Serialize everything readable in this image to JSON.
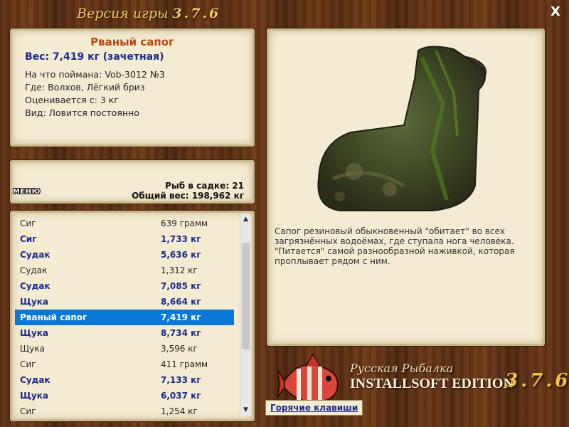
{
  "header": {
    "title": "Версия игры",
    "version": "3.7.6",
    "close_label": "X"
  },
  "info": {
    "name": "Рваный сапог",
    "weight": "Вес: 7,419 кг (зачетная)",
    "caught_on": "На что поймана: Vob-3012 №3",
    "where": "Где: Волхов, Лёгкий бриз",
    "valued_from": "Оценивается с: 3 кг",
    "kind": "Вид: Ловится постоянно"
  },
  "menu_label": "МЕНЮ",
  "stats": {
    "fish_count": "Рыб в садке: 21",
    "total_weight": "Общий вес: 198,962 кг"
  },
  "list": [
    {
      "name": "Сиг",
      "weight": "639 грамм",
      "style": "normal"
    },
    {
      "name": "Сиг",
      "weight": "1,733 кг",
      "style": "bold"
    },
    {
      "name": "Судак",
      "weight": "5,636 кг",
      "style": "bold"
    },
    {
      "name": "Судак",
      "weight": "1,312 кг",
      "style": "normal"
    },
    {
      "name": "Судак",
      "weight": "7,085 кг",
      "style": "bold"
    },
    {
      "name": "Щука",
      "weight": "8,664 кг",
      "style": "bold"
    },
    {
      "name": "Рваный сапог",
      "weight": "7,419 кг",
      "style": "selected"
    },
    {
      "name": "Щука",
      "weight": "8,734 кг",
      "style": "bold"
    },
    {
      "name": "Щука",
      "weight": "3,596 кг",
      "style": "normal"
    },
    {
      "name": "Сиг",
      "weight": "411 грамм",
      "style": "normal"
    },
    {
      "name": "Судак",
      "weight": "7,133 кг",
      "style": "bold"
    },
    {
      "name": "Щука",
      "weight": "6,037 кг",
      "style": "bold"
    },
    {
      "name": "Сиг",
      "weight": "1,254 кг",
      "style": "normal"
    }
  ],
  "description": "Сапог резиновый обыкновенный \"обитает\" во всех загрязнённых водоёмах, где ступала нога человека. \"Питается\" самой разнообразной наживкой, которая проплывает рядом с ним.",
  "logo": {
    "line1": "Русская Рыбалка",
    "line2": "INSTALLSOFT EDITION",
    "version": "3.7.6"
  },
  "hotkeys_label": "Горячие клавиши",
  "colors": {
    "accent_title": "#b8470e",
    "bold_text": "#1a2b8c",
    "selection": "#0a78d6",
    "panel_bg": "#f4ecd2"
  }
}
